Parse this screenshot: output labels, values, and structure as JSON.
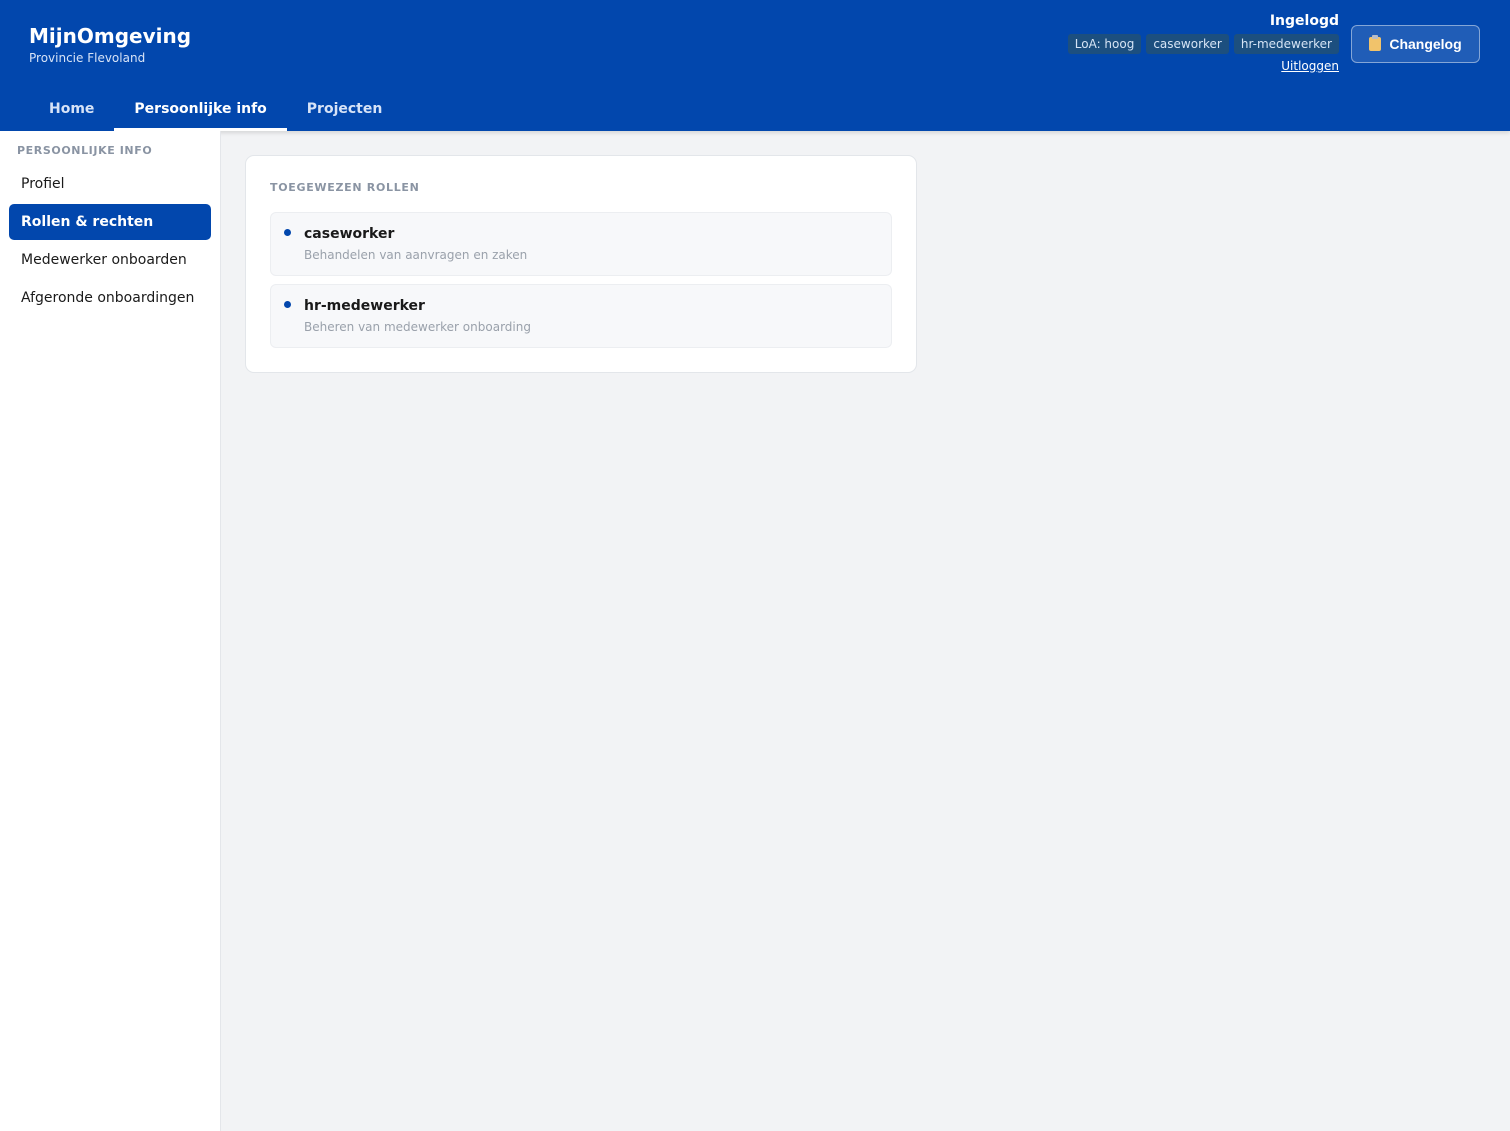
{
  "app": {
    "title": "MijnOmgeving",
    "subtitle": "Provincie Flevoland"
  },
  "user": {
    "status": "Ingelogd",
    "badges": [
      "LoA: hoog",
      "caseworker",
      "hr-medewerker"
    ],
    "logout_label": "Uitloggen"
  },
  "changelog": {
    "label": "Changelog",
    "icon": "clipboard-icon"
  },
  "tabs": [
    {
      "label": "Home",
      "active": false
    },
    {
      "label": "Persoonlijke info",
      "active": true
    },
    {
      "label": "Projecten",
      "active": false
    }
  ],
  "sidebar": {
    "heading": "PERSOONLIJKE INFO",
    "items": [
      {
        "label": "Profiel",
        "active": false
      },
      {
        "label": "Rollen & rechten",
        "active": true
      },
      {
        "label": "Medewerker onboarden",
        "active": false
      },
      {
        "label": "Afgeronde onboardingen",
        "active": false
      }
    ]
  },
  "roles_card": {
    "heading": "TOEGEWEZEN ROLLEN",
    "roles": [
      {
        "name": "caseworker",
        "description": "Behandelen van aanvragen en zaken"
      },
      {
        "name": "hr-medewerker",
        "description": "Beheren van medewerker onboarding"
      }
    ]
  },
  "colors": {
    "brand": "#0247ad",
    "background": "#f2f3f5",
    "accent_dot": "#0247ad"
  }
}
